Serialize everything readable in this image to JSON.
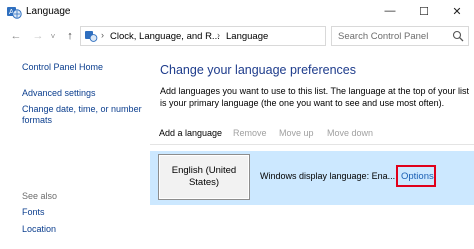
{
  "window": {
    "title": "Language",
    "minimize": "—",
    "maximize": "☐",
    "close": "✕"
  },
  "nav": {
    "back": "←",
    "forward": "→",
    "recent": "˅",
    "up": "↑",
    "breadcrumb": [
      "Clock, Language, and R...",
      "Language"
    ],
    "separator": "›",
    "dropdown": "˅",
    "refresh": "↻",
    "search_placeholder": "Search Control Panel"
  },
  "sidebar": {
    "home": "Control Panel Home",
    "links": [
      "Advanced settings",
      "Change date, time, or number",
      "formats"
    ],
    "see_also": "See also",
    "see_also_links": [
      "Fonts",
      "Location"
    ]
  },
  "main": {
    "heading": "Change your language preferences",
    "description": "Add languages you want to use to this list. The language at the top of your list is your primary language (the one you want to see and use most often).",
    "toolbar": {
      "add": "Add a language",
      "remove": "Remove",
      "move_up": "Move up",
      "move_down": "Move down"
    },
    "languages": [
      {
        "name": "English (United States)",
        "info": "Windows display language: Ena...",
        "options": "Options"
      }
    ]
  },
  "colors": {
    "accent": "#1e3c8c",
    "link": "#0b3e8e",
    "selection": "#cce8ff",
    "highlight": "#e0001a"
  },
  "icons": {
    "title": "language-icon",
    "search": "search-icon"
  }
}
